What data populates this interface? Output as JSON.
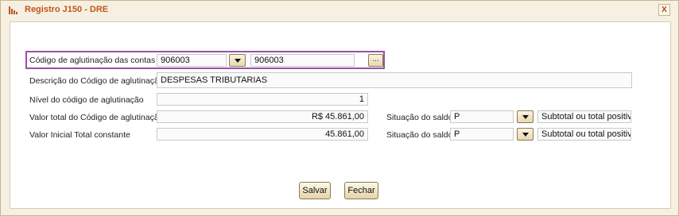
{
  "window": {
    "title": "Registro J150 - DRE",
    "close_label": "X"
  },
  "form": {
    "codigo_label": "Código de aglutinação das contas",
    "codigo_value": "906003",
    "codigo_desc_value": "906003",
    "ellipsis_label": "...",
    "descricao_label": "Descrição do Código de aglutinação",
    "descricao_value": "DESPESAS TRIBUTARIAS",
    "nivel_label": "Nível do código de aglutinação",
    "nivel_value": "1",
    "valor_total_label": "Valor total do Código de aglutinação",
    "valor_total_value": "R$ 45.861,00",
    "situacao1_label": "Situação do saldo",
    "situacao1_value": "P",
    "situacao1_desc": "Subtotal ou total positivo",
    "valor_inicial_label": "Valor Inicial Total constante",
    "valor_inicial_value": "45.861,00",
    "situacao2_label": "Situação do saldo",
    "situacao2_value": "P",
    "situacao2_desc": "Subtotal ou total positivo"
  },
  "buttons": {
    "save_label": "Salvar",
    "close_label": "Fechar"
  },
  "colors": {
    "title": "#c0561c",
    "highlight": "#9c4fa8",
    "frame": "#f6f0e2"
  }
}
